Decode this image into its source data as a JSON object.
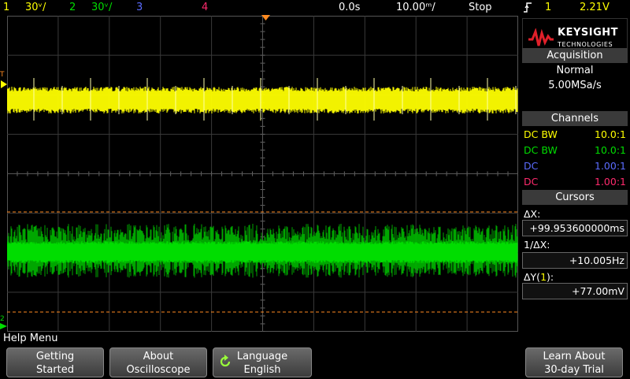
{
  "topbar": {
    "ch1_num": "1",
    "ch1_scale": "30ᵛ/",
    "ch2_num": "2",
    "ch2_scale": "30ᵛ/",
    "ch3_num": "3",
    "ch4_num": "4",
    "time_offset": "0.0s",
    "time_scale": "10.00ᵐ/",
    "run_state": "Stop",
    "trigger_icon": "rising-edge-icon",
    "trigger_channel": "1",
    "trigger_level": "2.21V"
  },
  "colors": {
    "ch1": "#ffff00",
    "ch2": "#00dd00",
    "ch3": "#5b6cff",
    "ch4": "#ff2a6d",
    "cursor": "#ff8a1f",
    "grid": "#3a3a3a"
  },
  "screen": {
    "trigger_marker": "T",
    "ch1_marker": "1",
    "ch2_marker": "2"
  },
  "logo": {
    "brand": "KEYSIGHT",
    "tagline": "TECHNOLOGIES"
  },
  "acquisition": {
    "title": "Acquisition",
    "mode": "Normal",
    "rate": "5.00MSa/s"
  },
  "channels": {
    "title": "Channels",
    "rows": [
      {
        "coupling": "DC",
        "extra": "BW",
        "probe": "10.0:1"
      },
      {
        "coupling": "DC",
        "extra": "BW",
        "probe": "10.0:1"
      },
      {
        "coupling": "DC",
        "extra": "",
        "probe": "1.00:1"
      },
      {
        "coupling": "DC",
        "extra": "",
        "probe": "1.00:1"
      }
    ]
  },
  "cursors": {
    "title": "Cursors",
    "dx_label": "ΔX:",
    "dx_value": "+99.953600000ms",
    "inv_label": "1/ΔX:",
    "inv_value": "+10.005Hz",
    "dy_label_pre": "ΔY(",
    "dy_channel": "1",
    "dy_label_post": "):",
    "dy_value": "+77.00mV"
  },
  "help": {
    "label": "Help Menu"
  },
  "softkeys": [
    {
      "line1": "Getting",
      "line2": "Started"
    },
    {
      "line1": "About",
      "line2": "Oscilloscope"
    },
    {
      "line1": "Language",
      "line2": "English",
      "icon": "cycle-arrow-icon"
    },
    {
      "line1": "Learn About",
      "line2": "30-day Trial"
    }
  ]
}
